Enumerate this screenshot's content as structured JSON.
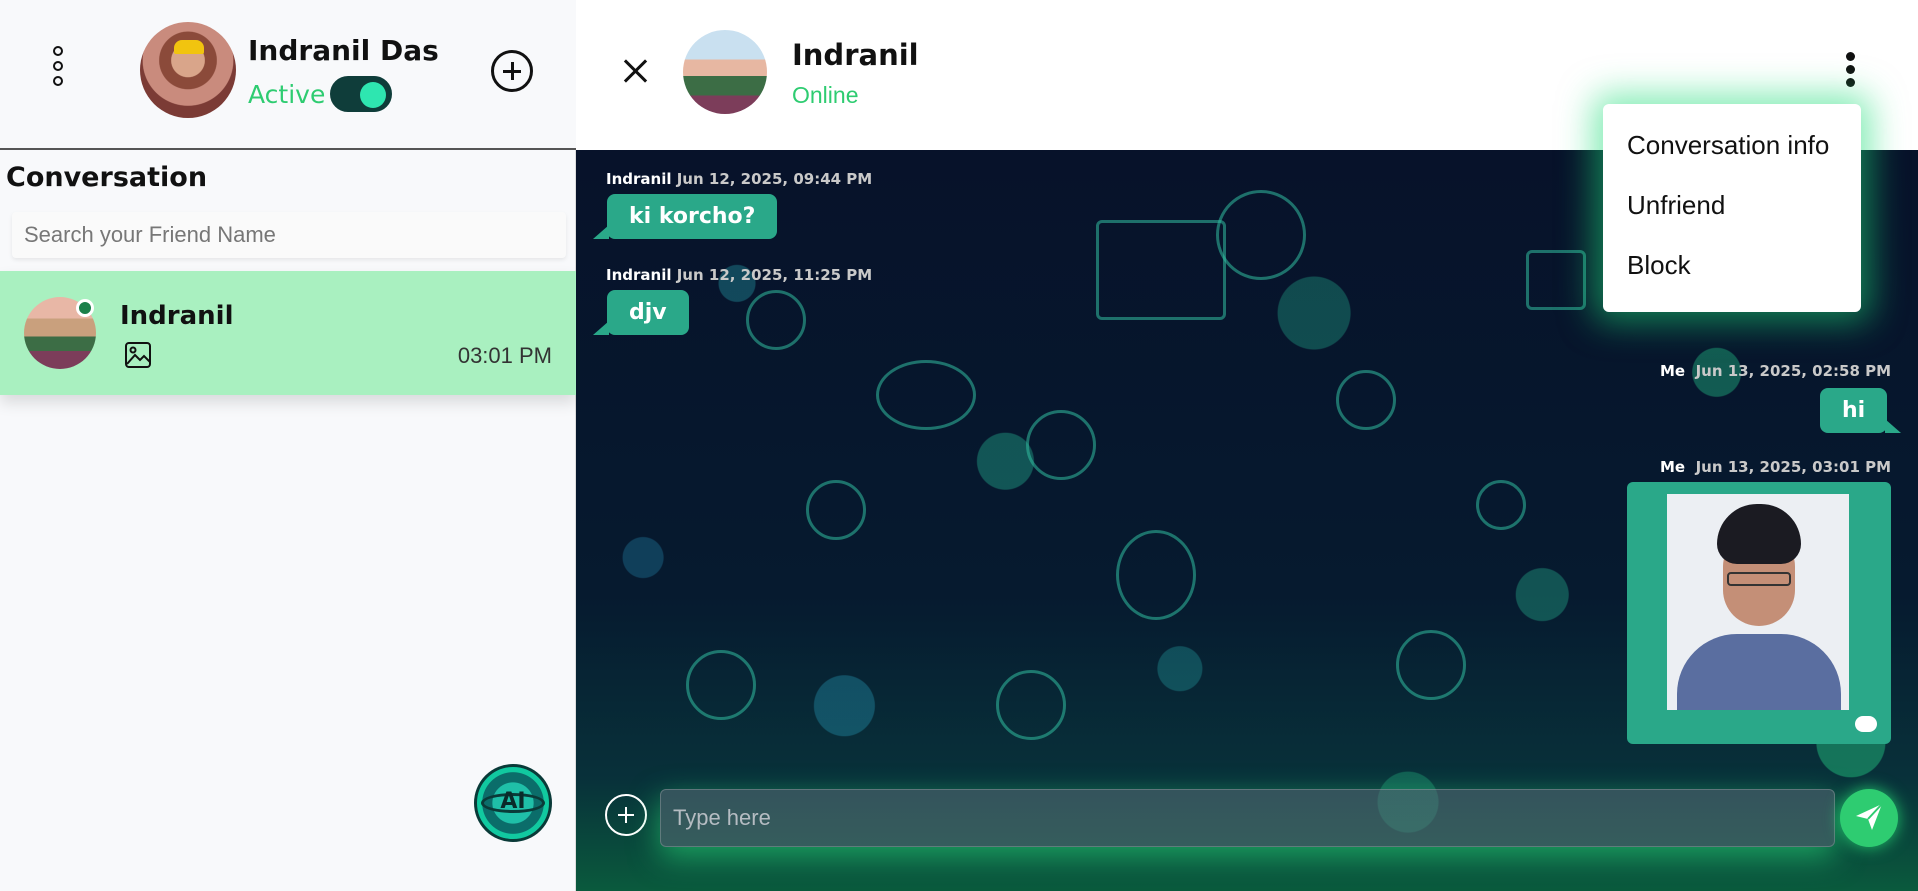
{
  "sidebar": {
    "user": {
      "name": "Indranil Das",
      "status": "Active",
      "toggle_on": true
    },
    "section_title": "Conversation",
    "search_placeholder": "Search your Friend Name",
    "conversations": [
      {
        "name": "Indranil",
        "time": "03:01 PM",
        "last_message_icon": "image-icon",
        "online": true
      }
    ],
    "ai_button_label": "AI"
  },
  "chat": {
    "partner": {
      "name": "Indranil",
      "status": "Online"
    },
    "menu": {
      "items": [
        "Conversation info",
        "Unfriend",
        "Block"
      ]
    },
    "messages": [
      {
        "sender": "Indranil",
        "time": "Jun 12, 2025, 09:44 PM",
        "text": "ki korcho?",
        "direction": "in"
      },
      {
        "sender": "Indranil",
        "time": "Jun 12, 2025, 11:25 PM",
        "text": "djv",
        "direction": "in"
      },
      {
        "sender": "Me",
        "time": "Jun 13, 2025, 02:58 PM",
        "text": "hi",
        "direction": "out"
      },
      {
        "sender": "Me",
        "time": "Jun 13, 2025, 03:01 PM",
        "type": "image",
        "direction": "out"
      }
    ],
    "composer": {
      "placeholder": "Type here"
    }
  },
  "colors": {
    "accent": "#2ecc71",
    "bubble": "#2aa889",
    "active_conv": "#a9f0c0",
    "chat_bg": "#07122a"
  }
}
